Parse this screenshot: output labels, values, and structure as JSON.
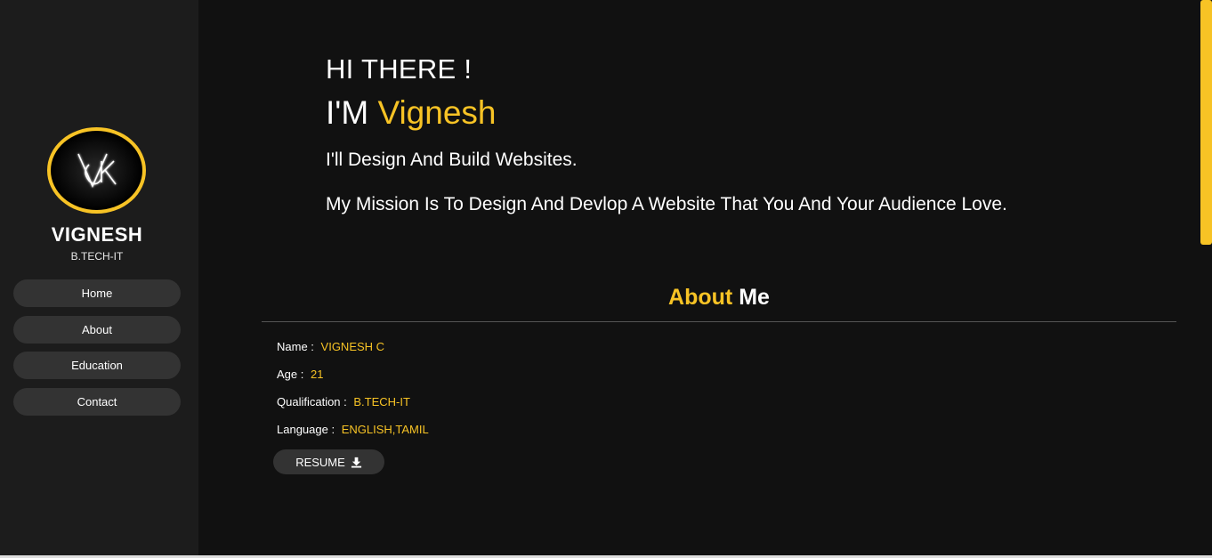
{
  "sidebar": {
    "logo_icon": "vk-monogram-icon",
    "name": "VIGNESH",
    "subtitle": "B.TECH-IT",
    "nav": [
      {
        "label": "Home"
      },
      {
        "label": "About"
      },
      {
        "label": "Education"
      },
      {
        "label": "Contact"
      }
    ]
  },
  "hero": {
    "greeting": "HI THERE !",
    "intro_prefix": "I'M",
    "intro_name": "Vignesh",
    "tagline": "I'll Design And Build Websites.",
    "mission": "My Mission Is To Design And Devlop A Website That You And Your Audience Love."
  },
  "about": {
    "title_accent": "About",
    "title_rest": "Me",
    "rows": [
      {
        "label": "Name :",
        "value": "VIGNESH C"
      },
      {
        "label": "Age :",
        "value": "21"
      },
      {
        "label": "Qualification :",
        "value": "B.TECH-IT"
      },
      {
        "label": "Language :",
        "value": "ENGLISH,TAMIL"
      }
    ],
    "resume_label": "RESUME",
    "resume_icon": "download-icon"
  },
  "colors": {
    "accent": "#f7c325",
    "background": "#111111",
    "sidebar": "#1c1c1c",
    "button": "#333333"
  }
}
